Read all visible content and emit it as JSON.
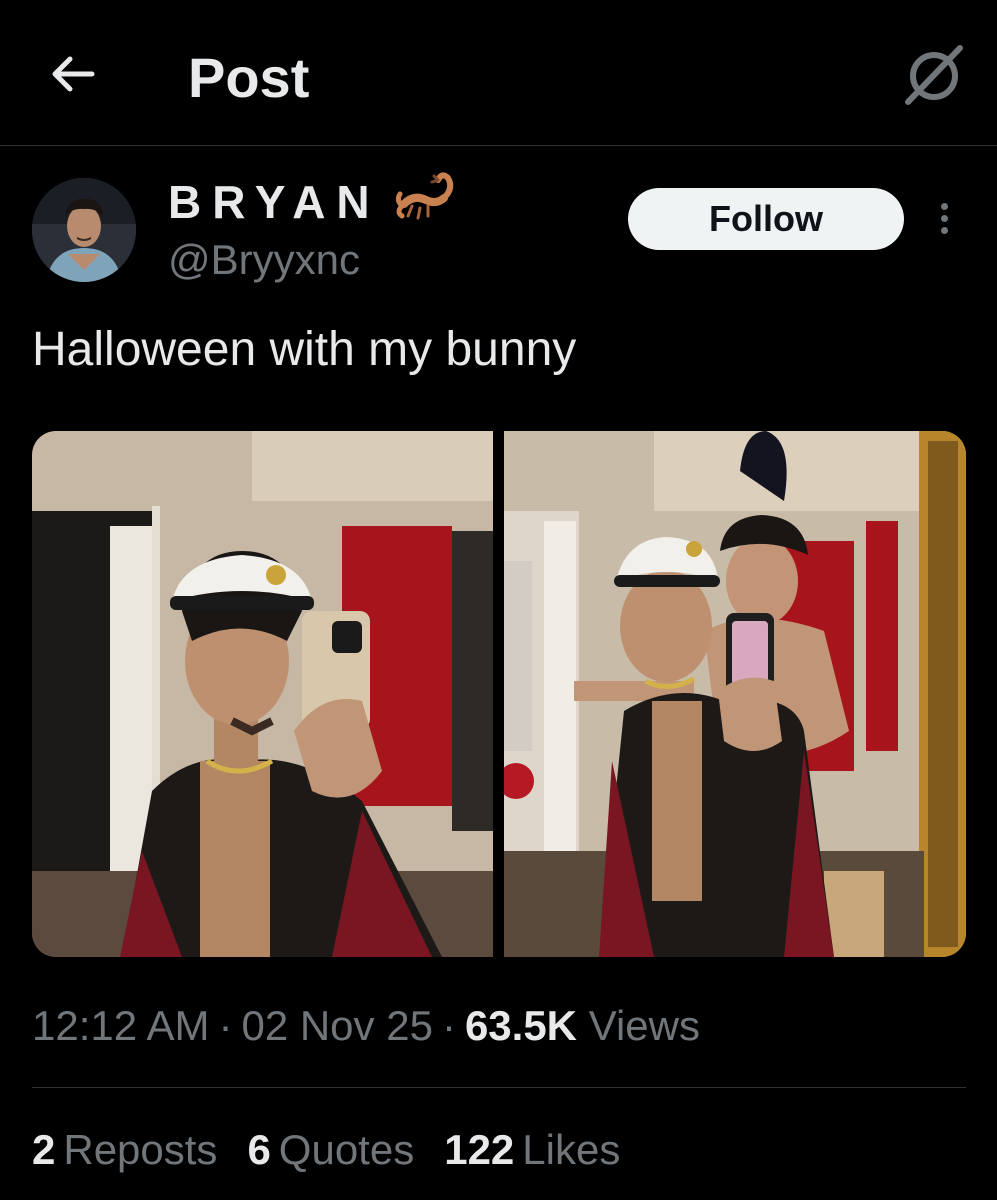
{
  "header": {
    "title": "Post",
    "back_icon": "arrow-left-icon",
    "grok_icon": "grok-icon"
  },
  "author": {
    "display_name": "BRYAN",
    "name_emoji": "scorpion-emoji",
    "handle": "@Bryyxnc"
  },
  "follow_label": "Follow",
  "more_icon": "more-vertical-icon",
  "post_text": "Halloween with my bunny",
  "media": {
    "images": [
      {
        "name": "mirror-selfie-sailor-hat"
      },
      {
        "name": "mirror-selfie-with-bunny"
      }
    ]
  },
  "meta": {
    "time": "12:12 AM",
    "separator": "·",
    "date": "02 Nov 25",
    "views_count": "63.5K",
    "views_label": "Views"
  },
  "stats": {
    "reposts_count": "2",
    "reposts_label": "Reposts",
    "quotes_count": "6",
    "quotes_label": "Quotes",
    "likes_count": "122",
    "likes_label": "Likes"
  },
  "colors": {
    "background": "#000000",
    "text_primary": "#e7e9ea",
    "text_secondary": "#71767b",
    "divider": "#2f3336",
    "follow_button_bg": "#eff3f4",
    "follow_button_text": "#0f1419"
  }
}
